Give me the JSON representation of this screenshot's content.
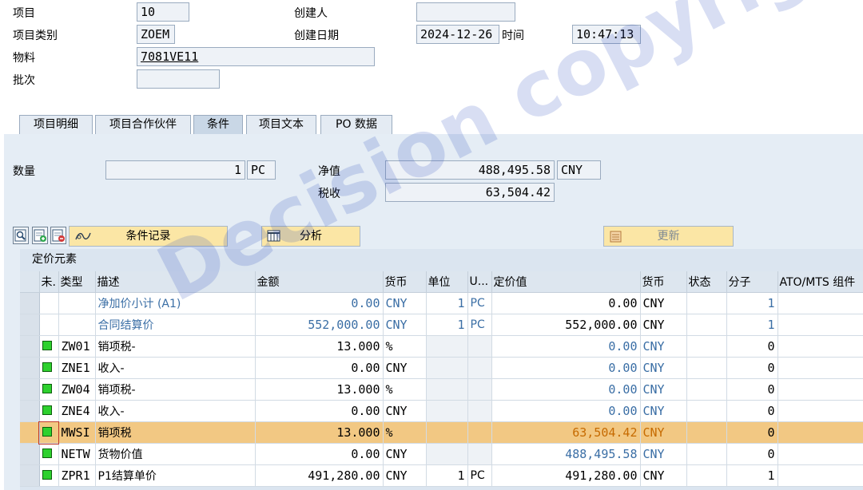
{
  "header": {
    "item_label": "项目",
    "item_value": "10",
    "creator_label": "创建人",
    "creator_value": "",
    "item_cat_label": "项目类别",
    "item_cat_value": "ZOEM",
    "created_date_label": "创建日期",
    "created_date_value": "2024-12-26",
    "time_label": "时间",
    "time_value": "10:47:13",
    "material_label": "物料",
    "material_value": "7081VE11",
    "batch_label": "批次",
    "batch_value": ""
  },
  "tabs": [
    "项目明细",
    "项目合作伙伴",
    "条件",
    "项目文本",
    "PO 数据"
  ],
  "active_tab": "条件",
  "summary": {
    "qty_label": "数量",
    "qty_value": "1",
    "qty_unit": "PC",
    "net_label": "净值",
    "net_value": "488,495.58",
    "net_currency": "CNY",
    "tax_label": "税收",
    "tax_value": "63,504.42"
  },
  "toolbar": {
    "cond_record_label": "条件记录",
    "analysis_label": "分析",
    "update_label": "更新",
    "icons": [
      "detail-icon",
      "insert-row-icon",
      "delete-row-icon",
      "condition-record-icon",
      "analysis-icon",
      "update-icon"
    ]
  },
  "grid": {
    "title": "定价元素",
    "columns": [
      "未.",
      "类型",
      "描述",
      "金额",
      "货币",
      "单位",
      "U...",
      "定价值",
      "货币",
      "状态",
      "分子",
      "ATO/MTS 组件"
    ],
    "rows": [
      {
        "led": false,
        "type": "",
        "desc": "净加价小计 (A1)",
        "amount": "0.00",
        "curr": "CNY",
        "unit": "1",
        "uom": "PC",
        "pval": "0.00",
        "pcurr": "CNY",
        "status": "",
        "num": "1",
        "blue": true
      },
      {
        "led": false,
        "type": "",
        "desc": "合同结算价",
        "amount": "552,000.00",
        "curr": "CNY",
        "unit": "1",
        "uom": "PC",
        "pval": "552,000.00",
        "pcurr": "CNY",
        "status": "",
        "num": "1",
        "blue": true
      },
      {
        "led": true,
        "type": "ZW01",
        "desc": "销项税-",
        "amount": "13.000",
        "curr": "%",
        "unit": "",
        "uom": "",
        "pval": "0.00",
        "pcurr": "CNY",
        "status": "",
        "num": "0",
        "pblue": true
      },
      {
        "led": true,
        "type": "ZNE1",
        "desc": "收入-",
        "amount": "0.00",
        "curr": "CNY",
        "unit": "",
        "uom": "",
        "pval": "0.00",
        "pcurr": "CNY",
        "status": "",
        "num": "0",
        "pblue": true
      },
      {
        "led": true,
        "type": "ZW04",
        "desc": "销项税-",
        "amount": "13.000",
        "curr": "%",
        "unit": "",
        "uom": "",
        "pval": "0.00",
        "pcurr": "CNY",
        "status": "",
        "num": "0",
        "pblue": true
      },
      {
        "led": true,
        "type": "ZNE4",
        "desc": "收入-",
        "amount": "0.00",
        "curr": "CNY",
        "unit": "",
        "uom": "",
        "pval": "0.00",
        "pcurr": "CNY",
        "status": "",
        "num": "0",
        "pblue": true
      },
      {
        "led": true,
        "type": "MWSI",
        "desc": "销项税",
        "amount": "13.000",
        "curr": "%",
        "unit": "",
        "uom": "",
        "pval": "63,504.42",
        "pcurr": "CNY",
        "status": "",
        "num": "0",
        "highlight": true
      },
      {
        "led": true,
        "type": "NETW",
        "desc": "货物价值",
        "amount": "0.00",
        "curr": "CNY",
        "unit": "",
        "uom": "",
        "pval": "488,495.58",
        "pcurr": "CNY",
        "status": "",
        "num": "0",
        "pblue": true
      },
      {
        "led": true,
        "type": "ZPR1",
        "desc": "P1结算单价",
        "amount": "491,280.00",
        "curr": "CNY",
        "unit": "1",
        "uom": "PC",
        "pval": "491,280.00",
        "pcurr": "CNY",
        "status": "",
        "num": "1"
      }
    ]
  },
  "watermark": "Decision copyright",
  "colors": {
    "highlight_row": "#f2c883",
    "button_yellow": "#fbe6a5",
    "link_blue": "#3a6ea5",
    "led_green": "#2ed12e"
  }
}
